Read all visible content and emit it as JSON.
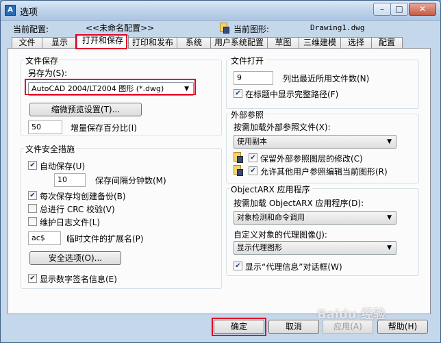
{
  "window": {
    "title": "选项",
    "app_icon": "A",
    "buttons": {
      "minimize": "–",
      "maximize": "□",
      "close": "✕"
    }
  },
  "profile": {
    "current_config_label": "当前配置:",
    "current_config_value": "<<未命名配置>>",
    "current_drawing_label": "当前图形:",
    "current_drawing_value": "Drawing1.dwg"
  },
  "tabs": [
    "文件",
    "显示",
    "打开和保存",
    "打印和发布",
    "系统",
    "用户系统配置",
    "草图",
    "三维建模",
    "选择",
    "配置"
  ],
  "active_tab": "打开和保存",
  "file_save": {
    "title": "文件保存",
    "save_as_label": "另存为(S):",
    "save_as_value": "AutoCAD 2004/LT2004 图形 (*.dwg)",
    "thumbnail_button": "缩微预览设置(T)...",
    "incremental_value": "50",
    "incremental_label": "增量保存百分比(I)"
  },
  "file_safety": {
    "title": "文件安全措施",
    "autosave_label": "自动保存(U)",
    "autosave_checked": true,
    "minutes_value": "10",
    "minutes_label": "保存间隔分钟数(M)",
    "backup_label": "每次保存均创建备份(B)",
    "backup_checked": true,
    "crc_label": "总进行 CRC 校验(V)",
    "crc_checked": false,
    "log_label": "维护日志文件(L)",
    "log_checked": false,
    "ext_value": "ac$",
    "ext_label": "临时文件的扩展名(P)",
    "security_button": "安全选项(O)...",
    "signature_label": "显示数字签名信息(E)",
    "signature_checked": true
  },
  "file_open": {
    "title": "文件打开",
    "recent_value": "9",
    "recent_label": "列出最近所用文件数(N)",
    "fullpath_label": "在标题中显示完整路径(F)",
    "fullpath_checked": true
  },
  "xref": {
    "title": "外部参照",
    "demand_label": "按需加载外部参照文件(X):",
    "demand_value": "使用副本",
    "retain_label": "保留外部参照图层的修改(C)",
    "retain_checked": true,
    "allow_label": "允许其他用户参照编辑当前图形(R)",
    "allow_checked": true
  },
  "objectarx": {
    "title": "ObjectARX 应用程序",
    "demand_label": "按需加载 ObjectARX 应用程序(D):",
    "demand_value": "对象检测和命令调用",
    "proxy_label": "自定义对象的代理图像(J):",
    "proxy_value": "显示代理图形",
    "proxy_info_label": "显示“代理信息”对话框(W)",
    "proxy_info_checked": true
  },
  "dialog_buttons": {
    "ok": "确定",
    "cancel": "取消",
    "apply": "应用(A)",
    "help": "帮助(H)"
  },
  "watermark": "Baidu 经验",
  "colors": {
    "highlight": "#e0002a",
    "titlebar": "#bcd2ea",
    "page_bg": "#fbfbfb"
  }
}
